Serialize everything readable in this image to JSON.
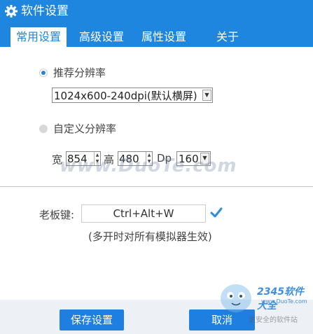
{
  "window": {
    "title": "软件设置",
    "accent": "#1f86e0"
  },
  "tabs": [
    {
      "label": "常用设置",
      "active": true
    },
    {
      "label": "高级设置",
      "active": false
    },
    {
      "label": "属性设置",
      "active": false
    },
    {
      "label": "关于",
      "active": false
    }
  ],
  "resolution": {
    "recommended": {
      "label": "推荐分辨率",
      "selected": true,
      "value": "1024x600-240dpi(默认横屏)"
    },
    "custom": {
      "label": "自定义分辨率",
      "selected": false,
      "width_label": "宽",
      "width_value": "854",
      "height_label": "高",
      "height_value": "480",
      "dpi_label": "Dp",
      "dpi_value": "160"
    }
  },
  "boss_key": {
    "label": "老板键:",
    "value": "Ctrl+Alt+W",
    "note": "(多开时对所有模拟器生效)"
  },
  "buttons": {
    "save": "保存设置",
    "cancel": "取消"
  },
  "watermark": {
    "text": "www.DuoTe.com"
  },
  "badge": {
    "logo": "2345软件大全",
    "site": "www.DuoTe.com",
    "slogan": "更安全的软件站"
  }
}
